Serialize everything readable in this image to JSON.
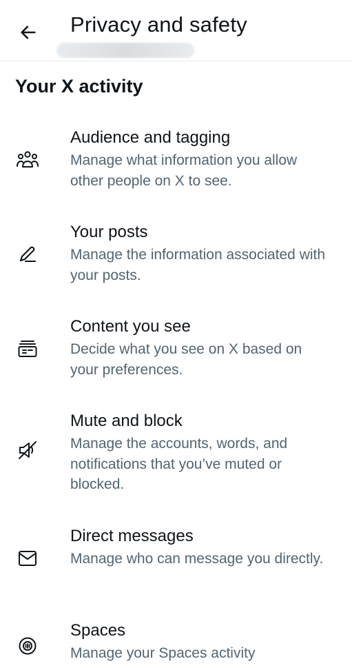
{
  "header": {
    "back_icon": "arrow-left-icon",
    "title": "Privacy and safety"
  },
  "section": {
    "title": "Your X activity"
  },
  "items": [
    {
      "icon": "people-icon",
      "label": "Audience and tagging",
      "description": "Manage what information you allow other people on X to see."
    },
    {
      "icon": "pen-icon",
      "label": "Your posts",
      "description": "Manage the information associated with your posts."
    },
    {
      "icon": "content-card-icon",
      "label": "Content you see",
      "description": "Decide what you see on X based on your preferences."
    },
    {
      "icon": "muted-speaker-icon",
      "label": "Mute and block",
      "description": "Manage the accounts, words, and notifications that you’ve muted or blocked."
    },
    {
      "icon": "envelope-icon",
      "label": "Direct messages",
      "description": "Manage who can message you directly."
    },
    {
      "icon": "spaces-icon",
      "label": "Spaces",
      "description": "Manage your Spaces activity"
    }
  ],
  "colors": {
    "text_primary": "#0f1419",
    "text_secondary": "#536471",
    "divider": "#e6e9ec"
  }
}
